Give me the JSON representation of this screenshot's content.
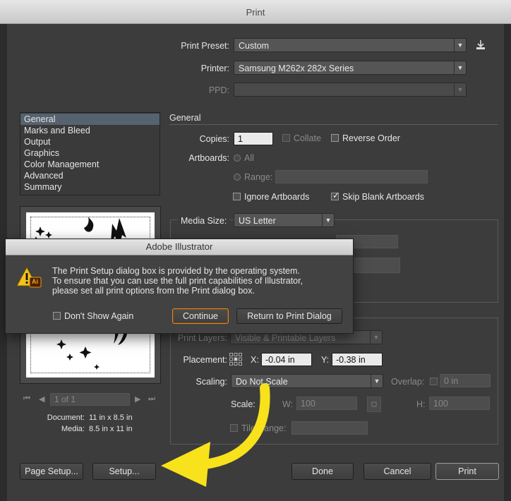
{
  "window": {
    "title": "Print"
  },
  "top": {
    "preset_label": "Print Preset:",
    "preset_value": "Custom",
    "printer_label": "Printer:",
    "printer_value": "Samsung M262x 282x Series",
    "ppd_label": "PPD:",
    "ppd_value": ""
  },
  "sidebar": {
    "items": [
      {
        "label": "General",
        "selected": true
      },
      {
        "label": "Marks and Bleed",
        "selected": false
      },
      {
        "label": "Output",
        "selected": false
      },
      {
        "label": "Graphics",
        "selected": false
      },
      {
        "label": "Color Management",
        "selected": false
      },
      {
        "label": "Advanced",
        "selected": false
      },
      {
        "label": "Summary",
        "selected": false
      }
    ]
  },
  "preview": {
    "page_nav": "1 of 1",
    "document_label": "Document:",
    "document_value": "11 in x 8.5 in",
    "media_label": "Media:",
    "media_value": "8.5 in x 11 in"
  },
  "general": {
    "section_title": "General",
    "copies_label": "Copies:",
    "copies_value": "1",
    "collate_label": "Collate",
    "reverse_label": "Reverse Order",
    "artboards_label": "Artboards:",
    "all_label": "All",
    "range_label": "Range:",
    "ignore_label": "Ignore Artboards",
    "skip_label": "Skip Blank Artboards"
  },
  "media": {
    "size_label": "Media Size:",
    "size_value": "US Letter"
  },
  "options": {
    "print_layers_label": "Print Layers:",
    "print_layers_value": "Visible & Printable Layers",
    "placement_label": "Placement:",
    "x_label": "X:",
    "x_value": "-0.04 in",
    "y_label": "Y:",
    "y_value": "-0.38 in",
    "scaling_label": "Scaling:",
    "scaling_value": "Do Not Scale",
    "overlap_label": "Overlap:",
    "overlap_value": "0 in",
    "scale_label": "Scale:",
    "w_label": "W:",
    "w_value": "100",
    "h_label": "H:",
    "h_value": "100",
    "tile_range_label": "Tile Range:"
  },
  "footer": {
    "page_setup": "Page Setup...",
    "setup": "Setup...",
    "done": "Done",
    "cancel": "Cancel",
    "print": "Print"
  },
  "alert": {
    "title": "Adobe Illustrator",
    "line1": "The Print Setup dialog box is provided by the operating system.",
    "line2": "To ensure that you can use the full print capabilities of Illustrator,",
    "line3": "please set all print options from the Print dialog box.",
    "dont_show": "Don't Show Again",
    "continue": "Continue",
    "return": "Return to Print Dialog",
    "icon_badge": "Ai"
  },
  "colors": {
    "arrow": "#f7e21b",
    "accent_border": "#d98a2b"
  }
}
